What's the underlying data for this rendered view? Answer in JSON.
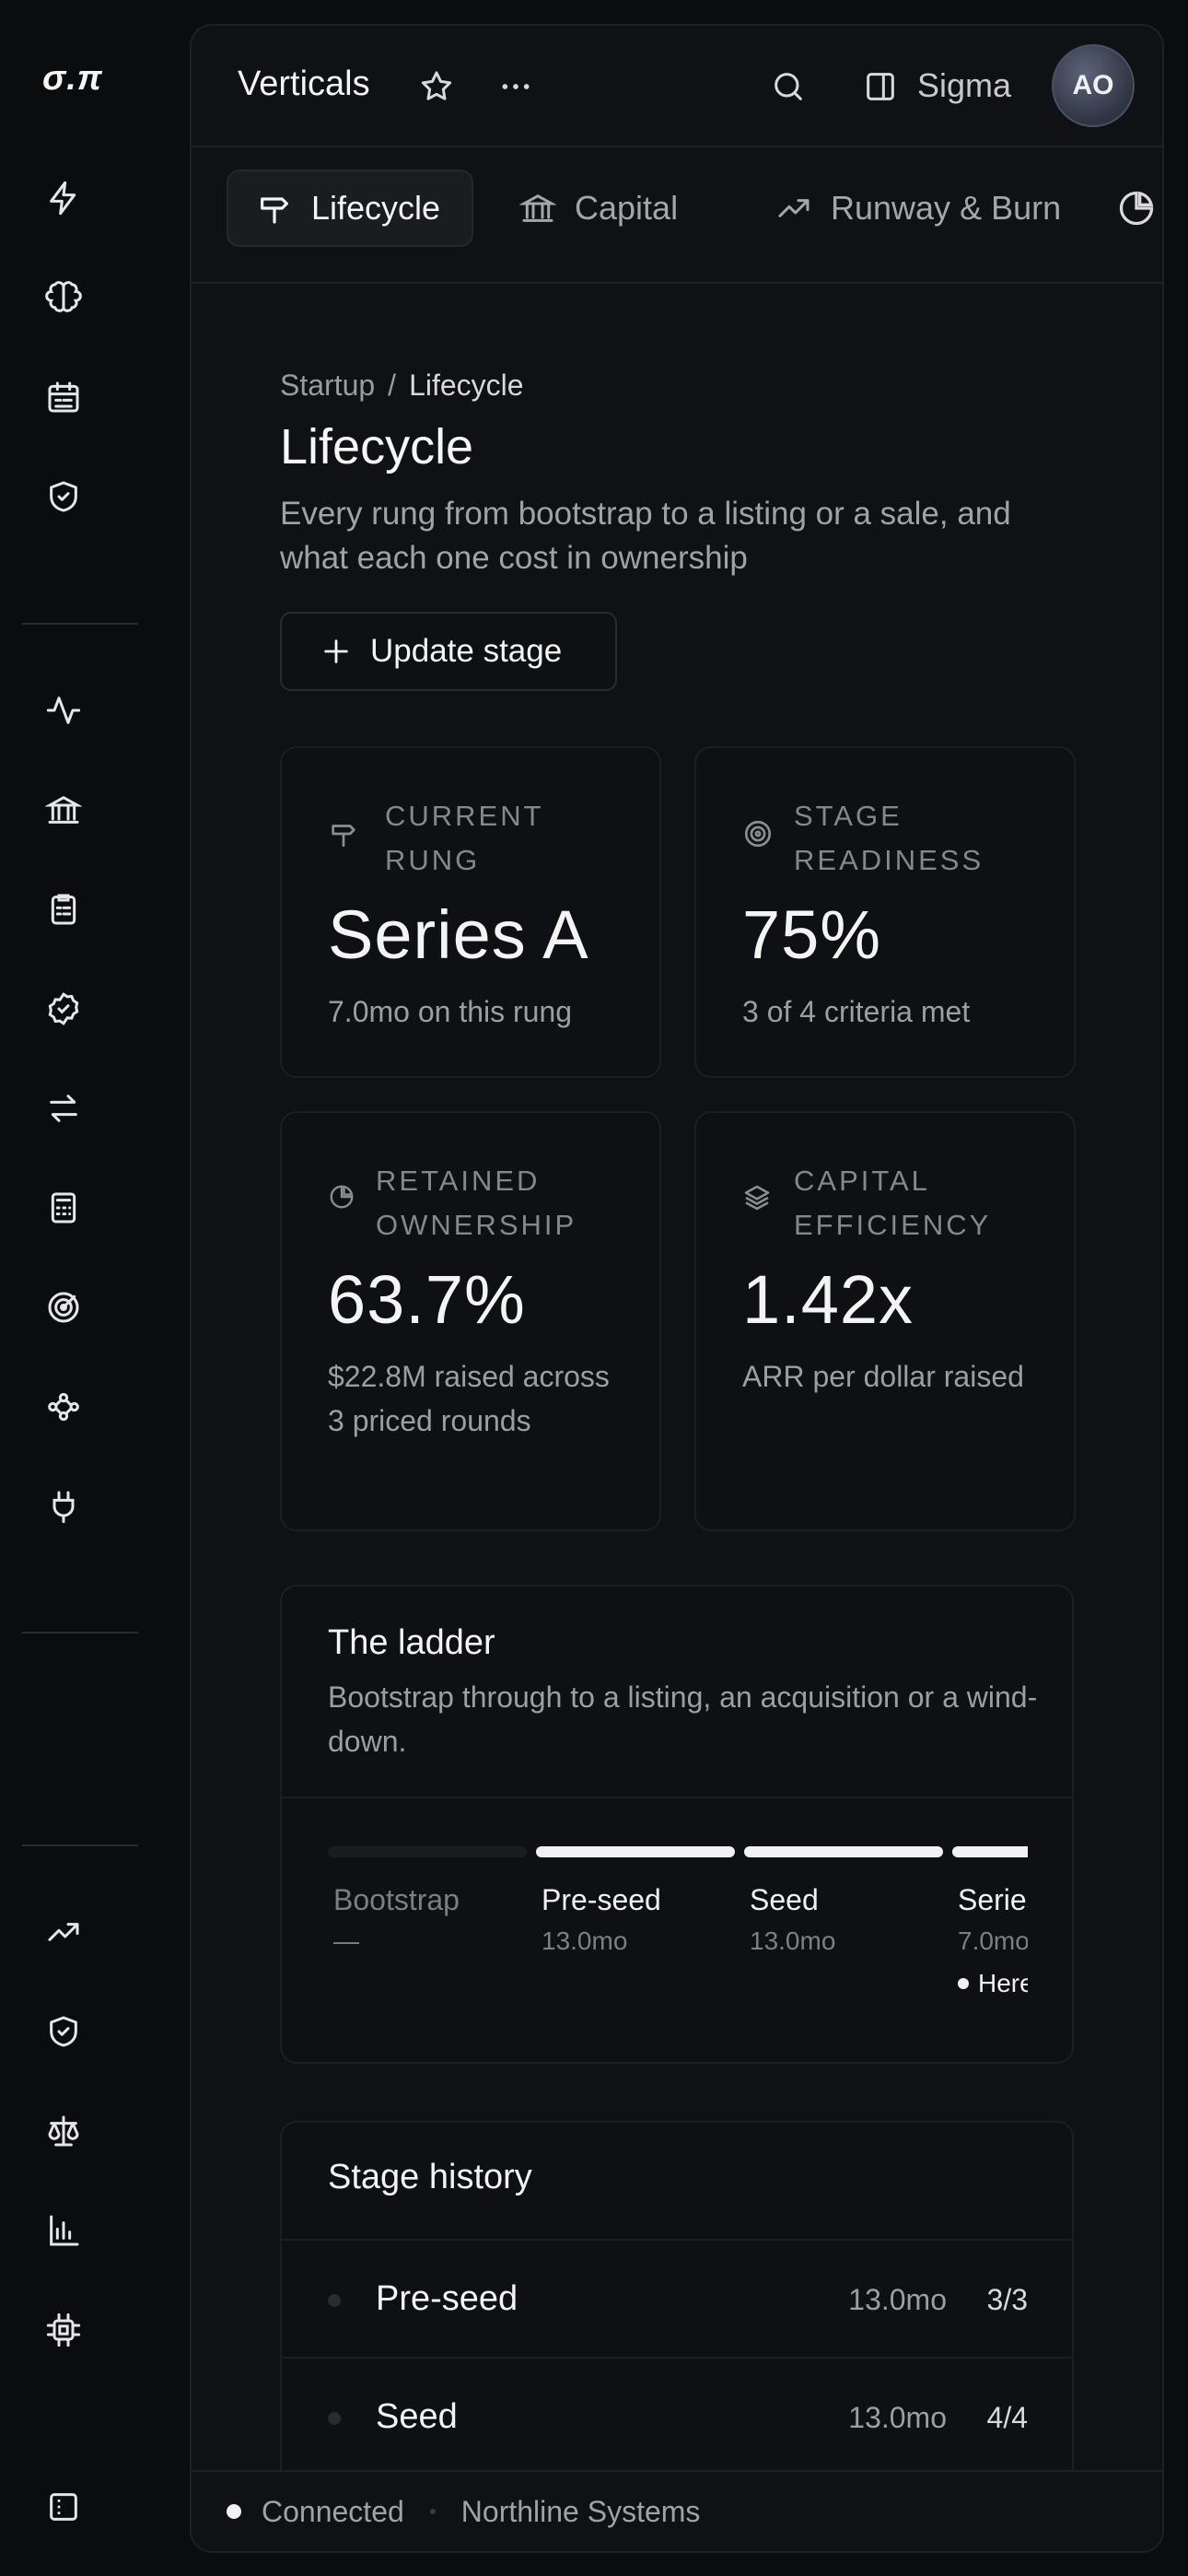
{
  "app": {
    "logo": "σ.π"
  },
  "topbar": {
    "title": "Verticals",
    "workspace": "Sigma",
    "avatar_initials": "AO"
  },
  "tabs": [
    {
      "label": "Lifecycle",
      "icon": "signpost-icon",
      "active": true
    },
    {
      "label": "Capital",
      "icon": "bank-icon",
      "active": false
    },
    {
      "label": "Runway & Burn",
      "icon": "trending-up-icon",
      "active": false
    }
  ],
  "breadcrumb": {
    "parent": "Startup",
    "separator": "/",
    "current": "Lifecycle"
  },
  "page": {
    "title": "Lifecycle",
    "subtitle": "Every rung from bootstrap to a listing or a sale, and what each one cost in ownership",
    "action_label": "Update stage"
  },
  "stats": [
    {
      "label": "Current rung",
      "value": "Series A",
      "note": "7.0mo on this rung",
      "icon": "signpost-icon"
    },
    {
      "label": "Stage readiness",
      "value": "75%",
      "note": "3 of 4 criteria met",
      "icon": "target-icon"
    },
    {
      "label": "Retained ownership",
      "value": "63.7%",
      "note": "$22.8M raised across 3 priced rounds",
      "icon": "pie-chart-icon"
    },
    {
      "label": "Capital efficiency",
      "value": "1.42x",
      "note": "ARR per dollar raised",
      "icon": "layers-icon"
    }
  ],
  "ladder": {
    "title": "The ladder",
    "subtitle": "Bootstrap through to a listing, an acquisition or a wind-down.",
    "rungs": [
      {
        "name": "Bootstrap",
        "duration": "—",
        "reached": false
      },
      {
        "name": "Pre-seed",
        "duration": "13.0mo",
        "reached": true
      },
      {
        "name": "Seed",
        "duration": "13.0mo",
        "reached": true
      },
      {
        "name": "Series A",
        "duration": "7.0mo",
        "reached": true,
        "marker": "Here"
      }
    ]
  },
  "history": {
    "title": "Stage history",
    "rows": [
      {
        "stage": "Pre-seed",
        "duration": "13.0mo",
        "criteria": "3/3"
      },
      {
        "stage": "Seed",
        "duration": "13.0mo",
        "criteria": "4/4"
      }
    ]
  },
  "status": {
    "connection": "Connected",
    "company": "Northline Systems"
  },
  "colors": {
    "background": "#0b0c0e",
    "panel": "#101114",
    "text": "#f4f4f5",
    "muted": "#9d9ea3"
  }
}
